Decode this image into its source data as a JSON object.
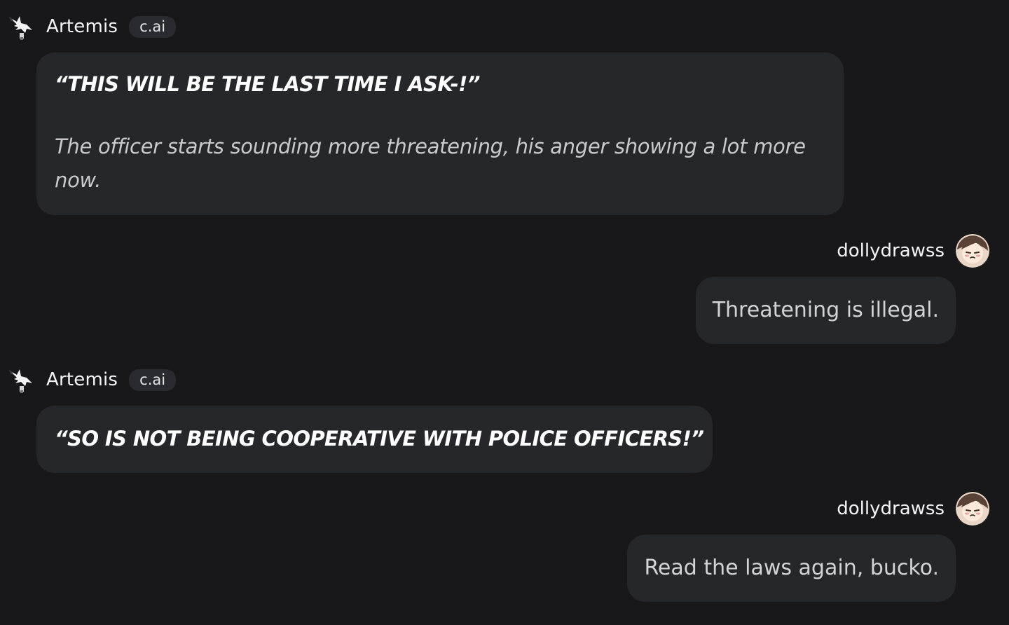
{
  "messages": [
    {
      "sender": "Artemis",
      "badge": "c.ai",
      "quote": "“THIS WILL BE THE LAST TIME I ASK-!”",
      "narration": "The officer starts sounding more threatening, his anger showing a lot more now."
    },
    {
      "sender": "dollydrawss",
      "text": "Threatening is illegal."
    },
    {
      "sender": "Artemis",
      "badge": "c.ai",
      "quote": "“SO IS NOT BEING COOPERATIVE WITH POLICE OFFICERS!”"
    },
    {
      "sender": "dollydrawss",
      "text": "Read the laws again, bucko."
    }
  ],
  "icons": {
    "character_avatar": "white-winged-figure-avatar",
    "user_avatar": "cartoon-girl-avatar"
  },
  "colors": {
    "background": "#18181b",
    "bubble": "#26272b",
    "badge": "#2a2b30"
  }
}
